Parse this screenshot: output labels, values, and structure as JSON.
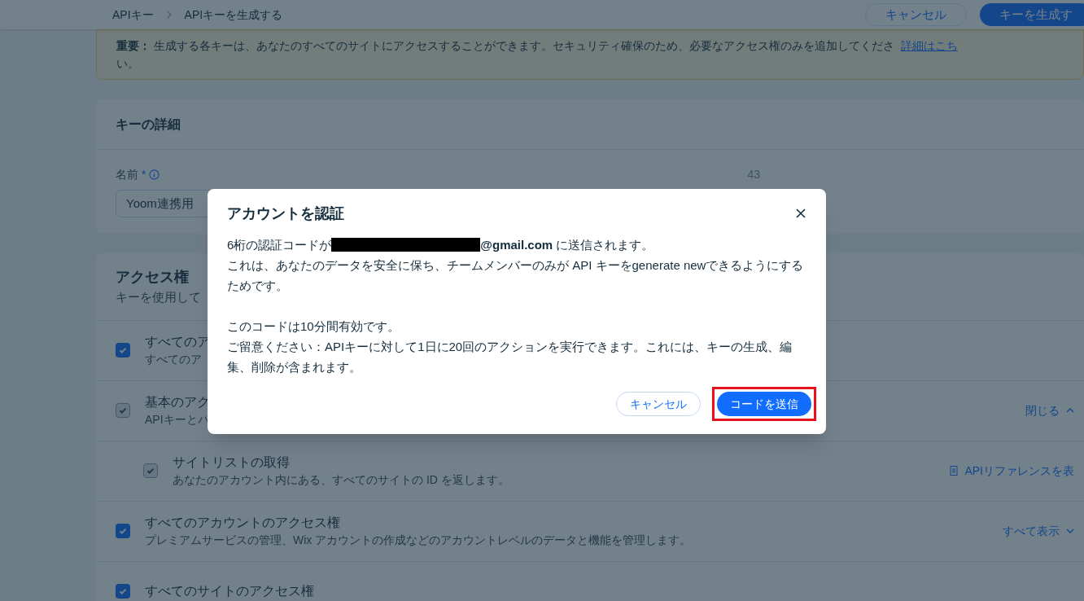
{
  "breadcrumb": [
    "APIキー",
    "APIキーを生成する"
  ],
  "header_buttons": [
    {
      "label": "キャンセル",
      "kind": "secondary"
    },
    {
      "label": "キーを生成す",
      "kind": "primary"
    }
  ],
  "notice": {
    "text": "**重要：** 生成する各キーは、あなたのすべてのサイトにアクセスすることができます。セキュリティ確保のため、必要なアクセス権のみを追加してくださ",
    "link": "詳細はこち",
    "continuation": "い。"
  },
  "key_details": {
    "title": "キーの詳細",
    "label": "名前",
    "required": "*",
    "counter": "43",
    "value": "Yoom連携用"
  },
  "access": {
    "title": "アクセス権",
    "subtitle": "キーを使用して",
    "rows": [
      {
        "title": "すべてのア",
        "description": "すべてのア",
        "checked": true,
        "disabled": false
      },
      {
        "title": "基本のアク",
        "description": "APIキーとパ",
        "checked": true,
        "disabled": true,
        "action": {
          "label": "閉じる",
          "kind": "collapse"
        },
        "children": [
          {
            "title": "サイトリストの取得",
            "description": "あなたのアカウント内にある、すべてのサイトの ID を返します。",
            "checked": true,
            "disabled": true,
            "action": {
              "label": "APIリファレンスを表",
              "kind": "reference"
            }
          }
        ]
      },
      {
        "title": "すべてのアカウントのアクセス権",
        "description": "プレミアムサービスの管理、Wix アカウントの作成などのアカウントレベルのデータと機能を管理します。",
        "checked": true,
        "disabled": false,
        "action": {
          "label": "すべて表示",
          "kind": "expand"
        }
      },
      {
        "title": "すべてのサイトのアクセス権",
        "checked": true,
        "disabled": false
      }
    ]
  },
  "dialog": {
    "title": "アカウントを認証",
    "code_line": {
      "prefix": "6桁の認証コードが",
      "redacted": true,
      "email_suffix": "@gmail.com",
      "suffix": " に送信されます。"
    },
    "paragraphs": [
      [
        "これは、あなたのデータを安全に保ち、チームメンバーのみが API キーをgenerate newできるようにするためです。"
      ],
      [
        "このコードは10分間有効です。",
        "ご留意ください：APIキーに対して1日に20回のアクションを実行できます。これには、キーの生成、編集、削除が含まれます。"
      ]
    ],
    "buttons": [
      {
        "label": "キャンセル",
        "kind": "secondary",
        "highlighted": false
      },
      {
        "label": "コードを送信",
        "kind": "primary",
        "highlighted": true
      }
    ]
  }
}
